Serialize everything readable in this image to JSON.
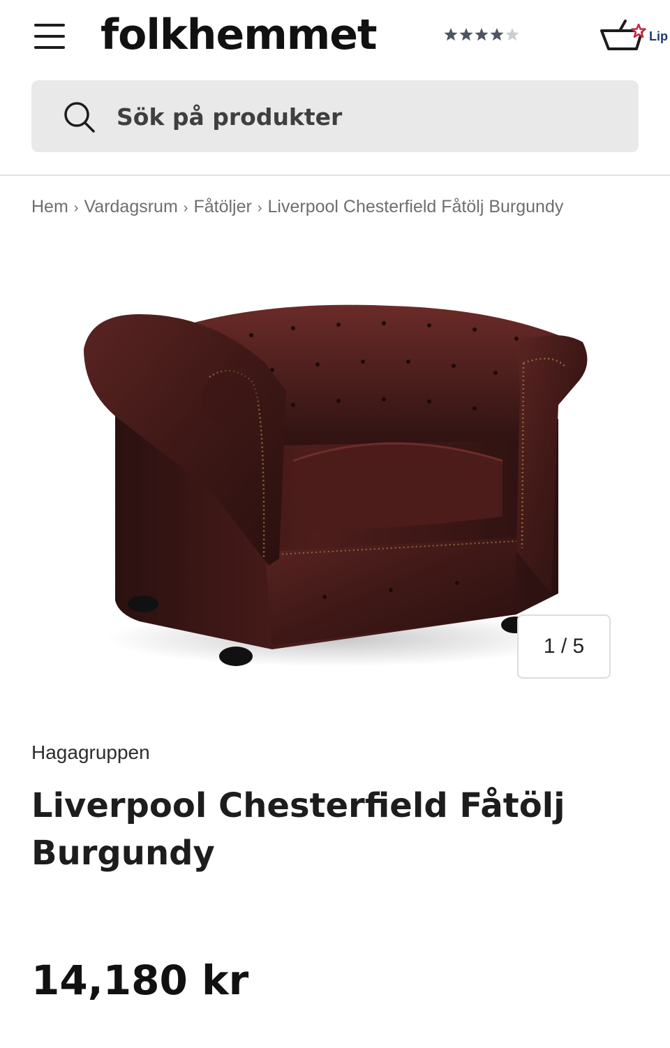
{
  "header": {
    "logo": "folkhemmet",
    "rating_stars": 4.5,
    "cart_label": "Lip"
  },
  "search": {
    "placeholder": "Sök på produkter"
  },
  "breadcrumb": {
    "items": [
      "Hem",
      "Vardagsrum",
      "Fåtöljer",
      "Liverpool Chesterfield Fåtölj Burgundy"
    ],
    "separator": "›"
  },
  "gallery": {
    "counter": "1 / 5",
    "current": 1,
    "total": 5
  },
  "product": {
    "brand": "Hagagruppen",
    "title": "Liverpool Chesterfield Fåtölj Burgundy",
    "price": "14,180 kr"
  },
  "colors": {
    "leather": "#4a1e1c",
    "accent_cart_star": "#c0263d",
    "cart_text": "#1e3a6e"
  }
}
